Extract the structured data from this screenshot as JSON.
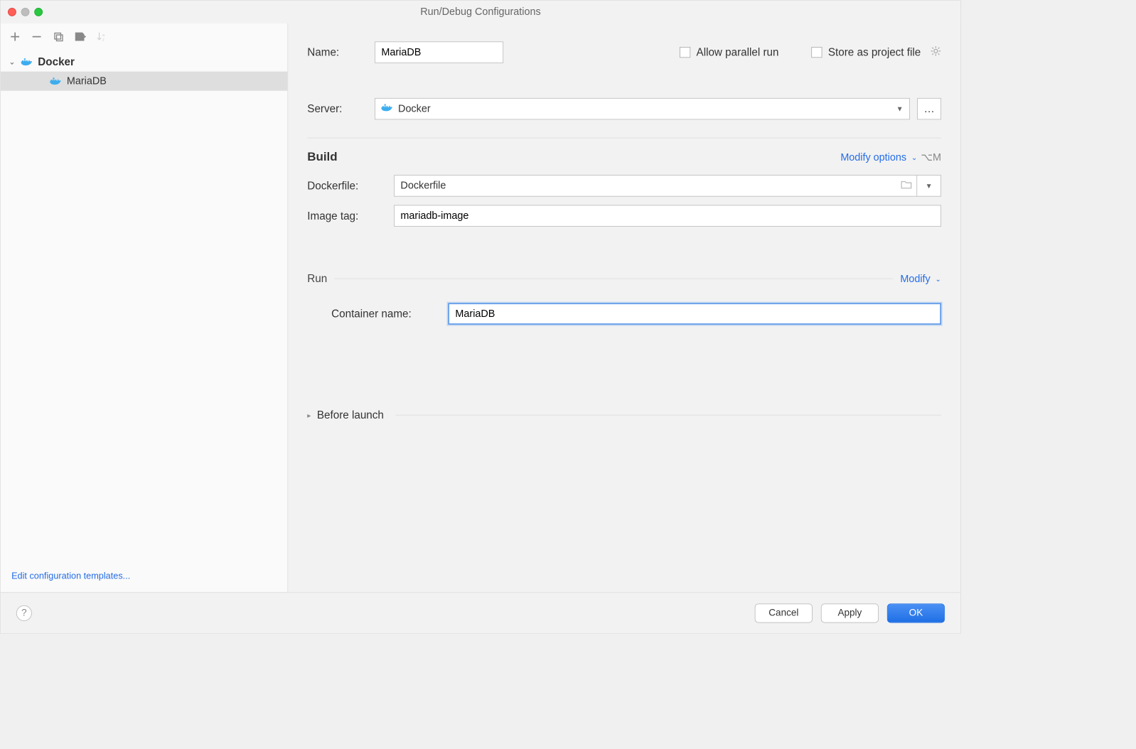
{
  "window": {
    "title": "Run/Debug Configurations"
  },
  "sidebar": {
    "root": "Docker",
    "child": "MariaDB",
    "editTemplates": "Edit configuration templates..."
  },
  "form": {
    "nameLabel": "Name:",
    "nameValue": "MariaDB",
    "allowParallel": "Allow parallel run",
    "storeProject": "Store as project file",
    "serverLabel": "Server:",
    "serverValue": "Docker"
  },
  "build": {
    "title": "Build",
    "modify": "Modify options",
    "shortcut": "⌥M",
    "dockerfileLabel": "Dockerfile:",
    "dockerfileValue": "Dockerfile",
    "imageTagLabel": "Image tag:",
    "imageTagValue": "mariadb-image"
  },
  "run": {
    "title": "Run",
    "modify": "Modify",
    "containerLabel": "Container name:",
    "containerValue": "MariaDB"
  },
  "beforeLaunch": {
    "title": "Before launch"
  },
  "footer": {
    "cancel": "Cancel",
    "apply": "Apply",
    "ok": "OK"
  }
}
